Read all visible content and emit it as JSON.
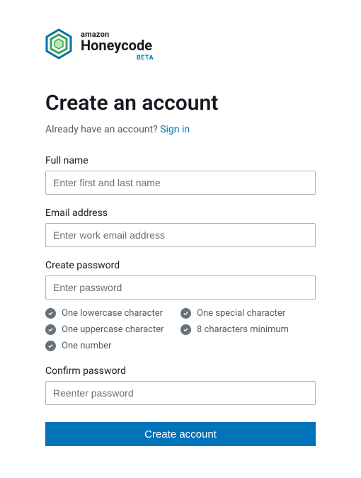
{
  "brand": {
    "amazon": "amazon",
    "product": "Honeycode",
    "beta": "BETA"
  },
  "heading": "Create an account",
  "have_account_text": "Already have an account? ",
  "sign_in_link": "Sign in",
  "fields": {
    "full_name": {
      "label": "Full name",
      "placeholder": "Enter first and last name",
      "value": ""
    },
    "email": {
      "label": "Email address",
      "placeholder": "Enter work email address",
      "value": ""
    },
    "password": {
      "label": "Create password",
      "placeholder": "Enter password",
      "value": ""
    },
    "confirm": {
      "label": "Confirm password",
      "placeholder": "Reenter password",
      "value": ""
    }
  },
  "password_requirements": [
    "One lowercase character",
    "One special character",
    "One uppercase character",
    "8 characters minimum",
    "One number"
  ],
  "submit_label": "Create account"
}
